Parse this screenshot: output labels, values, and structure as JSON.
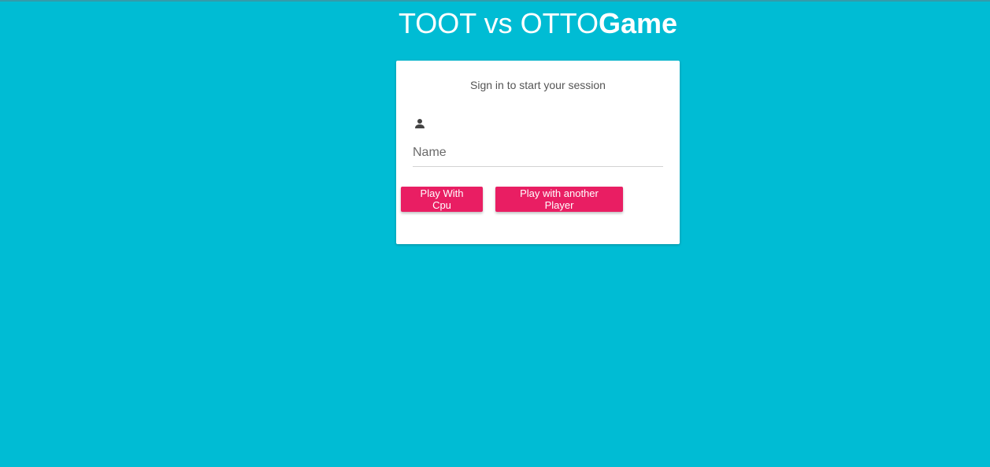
{
  "header": {
    "title_regular": "TOOT vs OTTO",
    "title_bold": "Game"
  },
  "login": {
    "session_message": "Sign in to start your session",
    "name_field": {
      "placeholder": "Name",
      "value": "",
      "icon": "person-icon"
    },
    "buttons": {
      "cpu_label": "Play With Cpu",
      "player_label": "Play with another Player"
    }
  },
  "colors": {
    "background": "#00bcd4",
    "card": "#ffffff",
    "accent": "#e91e63"
  }
}
